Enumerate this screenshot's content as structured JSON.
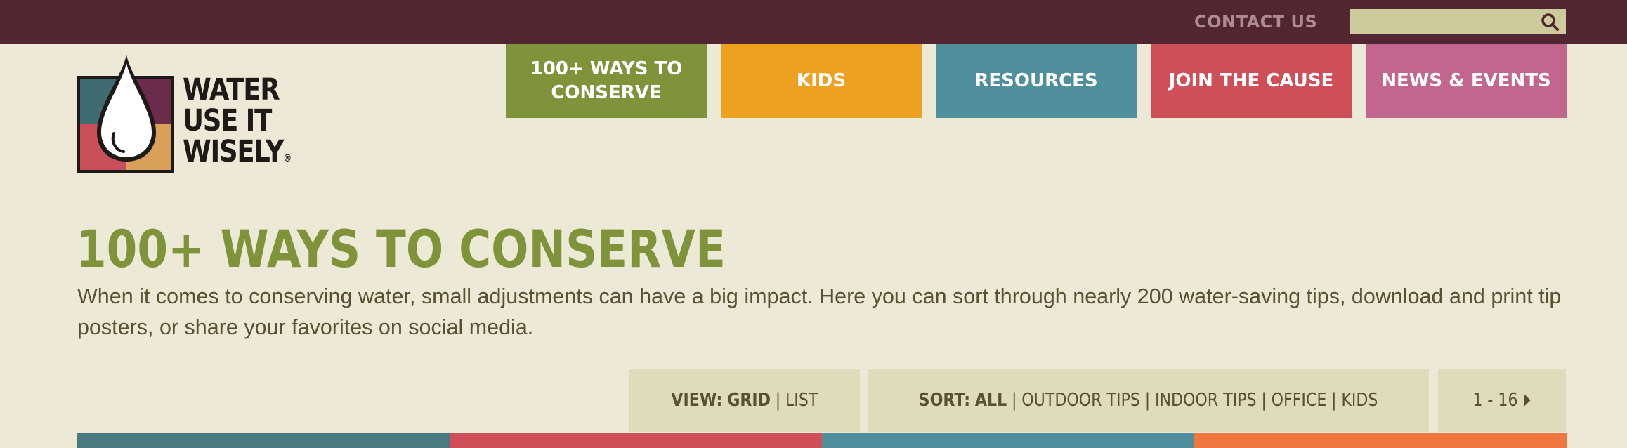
{
  "header": {
    "contact_label": "CONTACT US",
    "search": {
      "value": "",
      "placeholder": "",
      "icon": "search-icon"
    }
  },
  "logo": {
    "lines": [
      "WATER",
      "USE IT",
      "WISELY"
    ],
    "trademark": "®",
    "colors": {
      "quad_teal": "#3e6a70",
      "quad_plum": "#6b2b4d",
      "quad_red": "#c9505a",
      "quad_gold": "#d9a05a"
    }
  },
  "nav": {
    "items": [
      {
        "label": "100+ WAYS TO CONSERVE",
        "color": "#7f933b",
        "active": true
      },
      {
        "label": "KIDS",
        "color": "#eea120"
      },
      {
        "label": "RESOURCES",
        "color": "#4f8f9b"
      },
      {
        "label": "JOIN THE CAUSE",
        "color": "#cf4f58"
      },
      {
        "label": "NEWS & EVENTS",
        "color": "#c0668f"
      }
    ]
  },
  "main": {
    "title": "100+ WAYS TO CONSERVE",
    "intro": "When it comes to conserving water, small adjustments can have a big impact. Here you can sort through nearly 200 water-saving tips, download and print tip posters, or share your favorites on social media."
  },
  "controls": {
    "view": {
      "label": "VIEW:",
      "options": [
        "GRID",
        "LIST"
      ],
      "selected": "GRID"
    },
    "sort": {
      "label": "SORT:",
      "options": [
        "ALL",
        "OUTDOOR TIPS",
        "INDOOR TIPS",
        "OFFICE",
        "KIDS"
      ],
      "selected": "ALL"
    },
    "pagination": {
      "range": "1 - 16",
      "next_icon": "caret-right-icon"
    }
  },
  "tiles": {
    "colors": [
      "#4a7a80",
      "#cf4f58",
      "#4f8f9b",
      "#f07840"
    ]
  },
  "colors": {
    "page_background": "#ece9d7",
    "topbar": "#512630",
    "control_bar": "#dfdcbb",
    "title_green": "#7f933b"
  }
}
